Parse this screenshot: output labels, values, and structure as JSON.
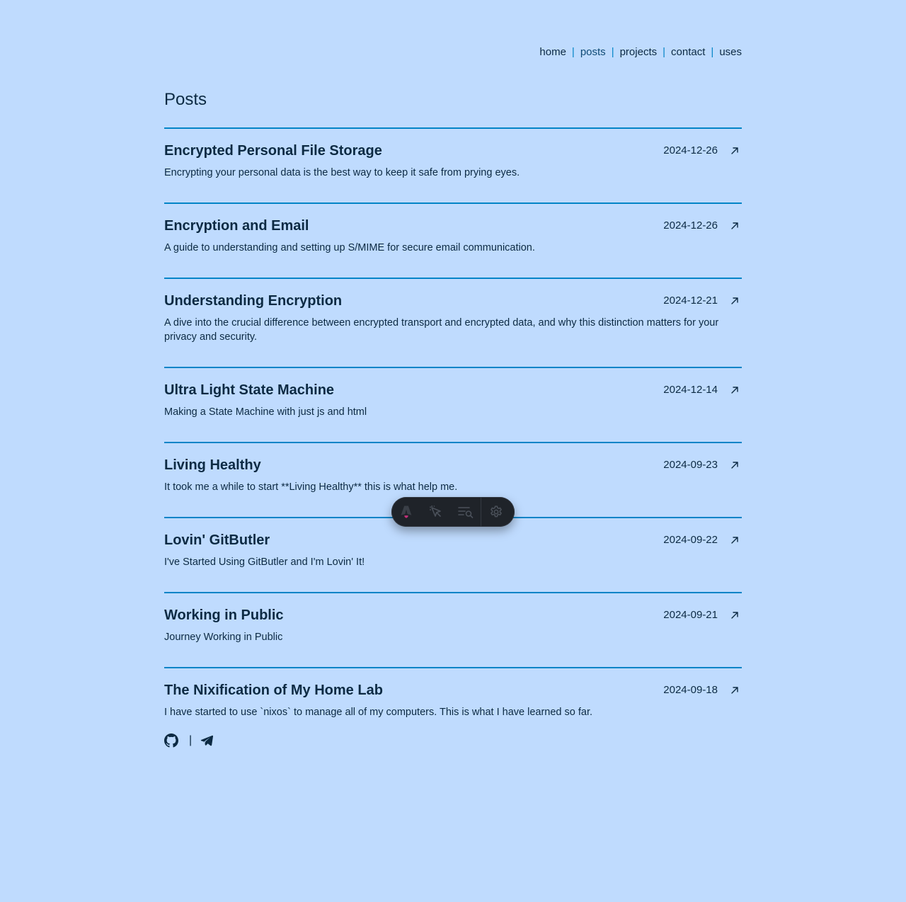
{
  "nav": {
    "items": [
      {
        "label": "home",
        "active": false
      },
      {
        "label": "posts",
        "active": true
      },
      {
        "label": "projects",
        "active": false
      },
      {
        "label": "contact",
        "active": false
      },
      {
        "label": "uses",
        "active": false
      }
    ],
    "separator": "|"
  },
  "page": {
    "title": "Posts"
  },
  "posts": [
    {
      "title": "Encrypted Personal File Storage",
      "date": "2024-12-26",
      "description": "Encrypting your personal data is the best way to keep it safe from prying eyes."
    },
    {
      "title": "Encryption and Email",
      "date": "2024-12-26",
      "description": "A guide to understanding and setting up S/MIME for secure email communication."
    },
    {
      "title": "Understanding Encryption",
      "date": "2024-12-21",
      "description": "A dive into the crucial difference between encrypted transport and encrypted data, and why this distinction matters for your privacy and security."
    },
    {
      "title": "Ultra Light State Machine",
      "date": "2024-12-14",
      "description": "Making a State Machine with just js and html"
    },
    {
      "title": "Living Healthy",
      "date": "2024-09-23",
      "description": "It took me a while to start **Living Healthy** this is what help me."
    },
    {
      "title": "Lovin' GitButler",
      "date": "2024-09-22",
      "description": "I've Started Using GitButler and I'm Lovin' It!"
    },
    {
      "title": "Working in Public",
      "date": "2024-09-21",
      "description": "Journey Working in Public"
    },
    {
      "title": "The Nixification of My Home Lab",
      "date": "2024-09-18",
      "description": "I have started to use `nixos` to manage all of my computers. This is what I have learned so far."
    }
  ],
  "post_link_icon": "arrow-up-right-icon",
  "footer": {
    "icons": [
      "github-icon",
      "telegram-icon"
    ],
    "separator": "|"
  },
  "dev_toolbar": {
    "buttons": [
      "astro-logo-icon",
      "inspect-cursor-icon",
      "audit-icon",
      "gear-icon"
    ]
  },
  "colors": {
    "background": "#bfdbfe",
    "text": "#0c2a43",
    "accent": "#0284c7",
    "toolbar": "#1f2329"
  }
}
